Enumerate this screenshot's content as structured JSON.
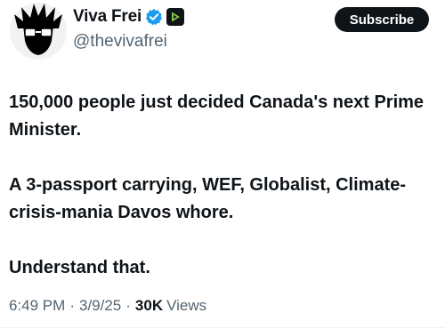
{
  "author": {
    "display_name": "Viva Frei",
    "handle": "@thevivafrei"
  },
  "subscribe_label": "Subscribe",
  "tweet": {
    "line1": "150,000 people just decided Canada's next Prime Minister.",
    "line2": "A 3-passport carrying, WEF, Globalist, Climate-crisis-mania Davos whore.",
    "line3": "Understand that."
  },
  "meta": {
    "time": "6:49 PM",
    "separator": "·",
    "date": "3/9/25",
    "views_count": "30K",
    "views_label": "Views"
  },
  "colors": {
    "verified": "#1d9bf0",
    "rumble": "#85c742",
    "text": "#0f1419",
    "secondary": "#536471"
  },
  "icons": {
    "verified": "verified-badge-icon",
    "affiliate": "rumble-logo-icon"
  }
}
